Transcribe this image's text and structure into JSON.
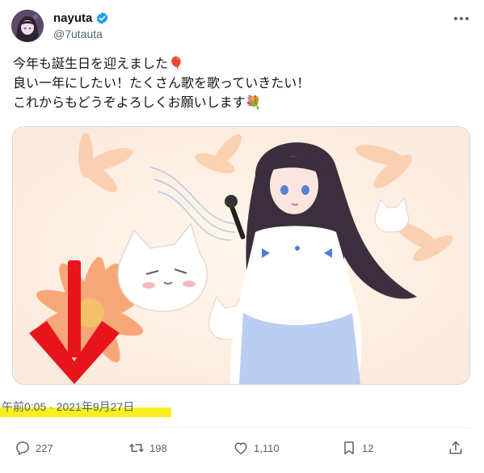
{
  "author": {
    "display_name": "nayuta",
    "handle": "@7utauta",
    "verified": true,
    "verified_color": "#1d9bf0"
  },
  "post": {
    "lines": [
      "今年も誕生日を迎えました🎈",
      "良い一年にしたい！たくさん歌を歌っていきたい！",
      "これからもどうぞよろしくお願いします💐"
    ],
    "timestamp": "午前0:05 · 2021年9月27日"
  },
  "actions": {
    "replies": "227",
    "reposts": "198",
    "likes": "1,110",
    "bookmarks": "12"
  },
  "icons": {
    "more": "more-dots-icon",
    "reply": "reply-icon",
    "repost": "repost-icon",
    "like": "heart-icon",
    "bookmark": "bookmark-icon",
    "share": "share-icon"
  },
  "colors": {
    "text_primary": "#0f1419",
    "text_secondary": "#536471",
    "highlight": "#f7ef20",
    "arrow": "#e8141b"
  }
}
